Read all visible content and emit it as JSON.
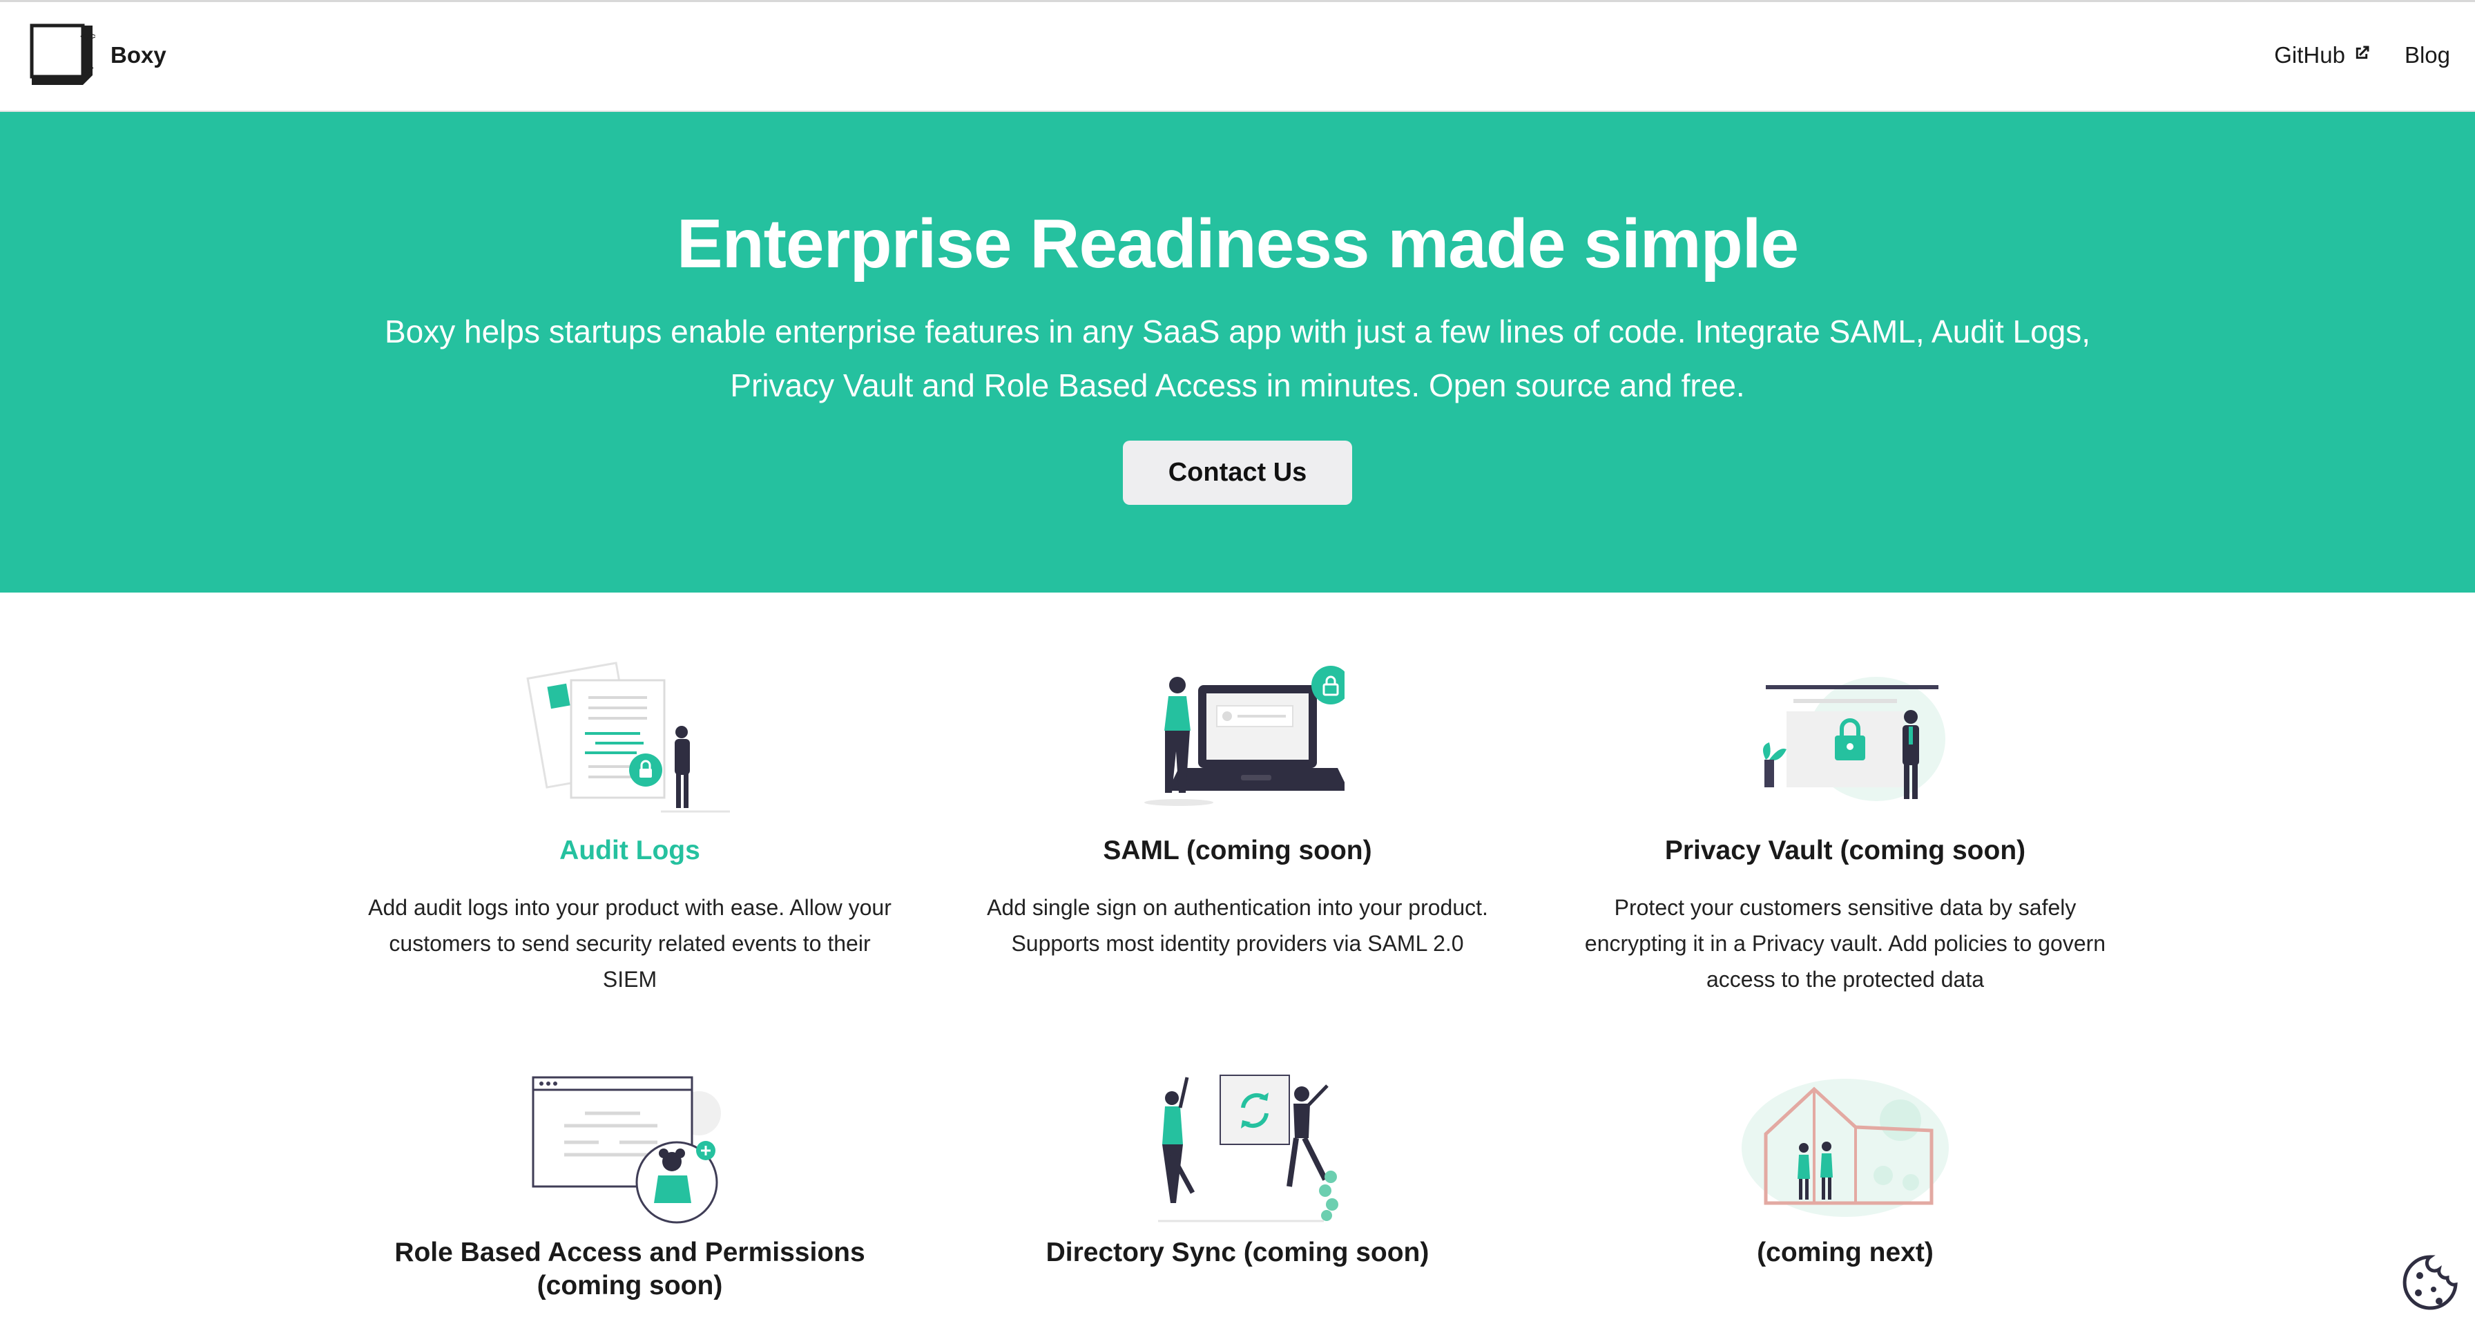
{
  "nav": {
    "brand": "Boxy",
    "links": [
      {
        "label": "GitHub",
        "external": true
      },
      {
        "label": "Blog",
        "external": false
      }
    ]
  },
  "hero": {
    "title": "Enterprise Readiness made simple",
    "subtitle": "Boxy helps startups enable enterprise features in any SaaS app with just a few lines of code. Integrate SAML, Audit Logs, Privacy Vault and Role Based Access in minutes. Open source and free.",
    "cta_label": "Contact Us"
  },
  "features": [
    {
      "title": "Audit Logs",
      "description": "Add audit logs into your product with ease. Allow your customers to send security related events to their SIEM",
      "highlighted": true,
      "icon": "audit-logs-illustration"
    },
    {
      "title": "SAML (coming soon)",
      "description": "Add single sign on authentication into your product. Supports most identity providers via SAML 2.0",
      "highlighted": false,
      "icon": "saml-illustration"
    },
    {
      "title": "Privacy Vault (coming soon)",
      "description": "Protect your customers sensitive data by safely encrypting it in a Privacy vault. Add policies to govern access to the protected data",
      "highlighted": false,
      "icon": "privacy-vault-illustration"
    },
    {
      "title": "Role Based Access and Permissions (coming soon)",
      "description": "",
      "highlighted": false,
      "icon": "role-based-access-illustration"
    },
    {
      "title": "Directory Sync (coming soon)",
      "description": "",
      "highlighted": false,
      "icon": "directory-sync-illustration"
    },
    {
      "title": "(coming next)",
      "description": "",
      "highlighted": false,
      "icon": "coming-next-illustration"
    }
  ],
  "colors": {
    "accent": "#25c19f",
    "text": "#1a1a1a",
    "button_bg": "#eeeef0"
  }
}
